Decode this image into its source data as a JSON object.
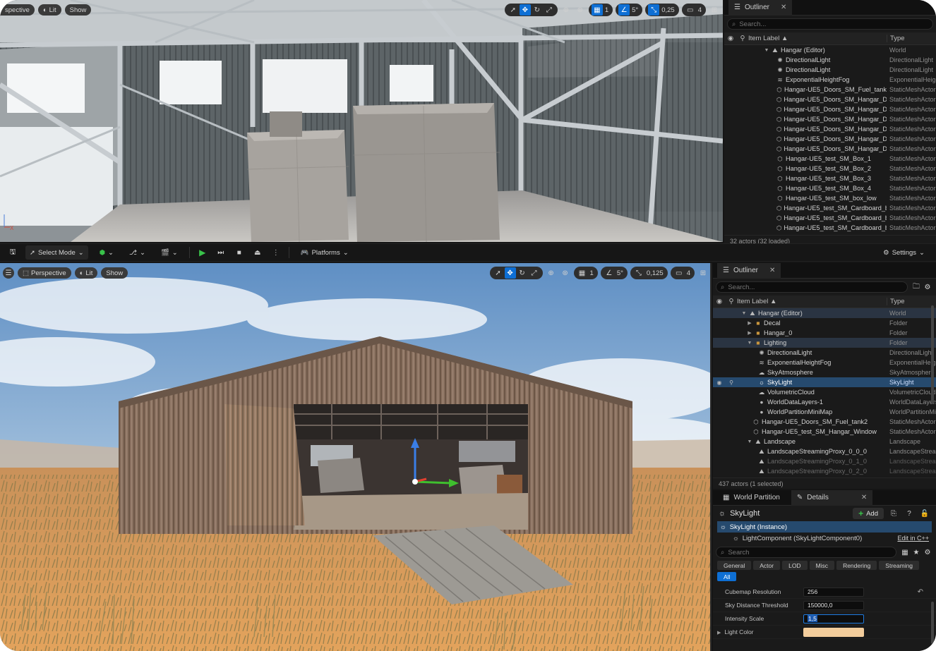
{
  "top_viewport": {
    "toolbar": {
      "mode": "spective",
      "lit": "Lit",
      "show": "Show"
    },
    "snap": {
      "grid": "1",
      "angle": "5°",
      "scale": "0,25",
      "cams": "4"
    }
  },
  "top_outliner": {
    "tab": "Outliner",
    "search_placeholder": "Search...",
    "col_label": "Item Label ▲",
    "col_type": "Type",
    "rows": [
      {
        "label": "Hangar (Editor)",
        "type": "World"
      },
      {
        "label": "DirectionalLight",
        "type": "DirectionalLight"
      },
      {
        "label": "DirectionalLight",
        "type": "DirectionalLight"
      },
      {
        "label": "ExponentialHeightFog",
        "type": "ExponentialHeightFog"
      },
      {
        "label": "Hangar-UE5_Doors_SM_Fuel_tank",
        "type": "StaticMeshActor"
      },
      {
        "label": "Hangar-UE5_Doors_SM_Hangar_Doo",
        "type": "StaticMeshActor"
      },
      {
        "label": "Hangar-UE5_Doors_SM_Hangar_Doo",
        "type": "StaticMeshActor"
      },
      {
        "label": "Hangar-UE5_Doors_SM_Hangar_Doo",
        "type": "StaticMeshActor"
      },
      {
        "label": "Hangar-UE5_Doors_SM_Hangar_Doo",
        "type": "StaticMeshActor"
      },
      {
        "label": "Hangar-UE5_Doors_SM_Hangar_Doo",
        "type": "StaticMeshActor"
      },
      {
        "label": "Hangar-UE5_Doors_SM_Hangar_Doo",
        "type": "StaticMeshActor"
      },
      {
        "label": "Hangar-UE5_test_SM_Box_1",
        "type": "StaticMeshActor"
      },
      {
        "label": "Hangar-UE5_test_SM_Box_2",
        "type": "StaticMeshActor"
      },
      {
        "label": "Hangar-UE5_test_SM_Box_3",
        "type": "StaticMeshActor"
      },
      {
        "label": "Hangar-UE5_test_SM_Box_4",
        "type": "StaticMeshActor"
      },
      {
        "label": "Hangar-UE5_test_SM_box_low",
        "type": "StaticMeshActor"
      },
      {
        "label": "Hangar-UE5_test_SM_Cardboard_box",
        "type": "StaticMeshActor"
      },
      {
        "label": "Hangar-UE5_test_SM_Cardboard_box",
        "type": "StaticMeshActor"
      },
      {
        "label": "Hangar-UE5_test_SM_Cardboard_box",
        "type": "StaticMeshActor"
      }
    ],
    "status": "32 actors (32 loaded)"
  },
  "main_toolbar": {
    "select_mode": "Select Mode",
    "platforms": "Platforms",
    "settings": "Settings"
  },
  "bottom_viewport": {
    "toolbar": {
      "mode": "Perspective",
      "lit": "Lit",
      "show": "Show"
    },
    "snap": {
      "grid": "1",
      "angle": "5°",
      "scale": "0,125",
      "cams": "4"
    }
  },
  "bottom_outliner": {
    "tab": "Outliner",
    "search_placeholder": "Search...",
    "col_label": "Item Label ▲",
    "col_type": "Type",
    "rows": [
      {
        "label": "Hangar (Editor)",
        "type": "World"
      },
      {
        "label": "Decal",
        "type": "Folder"
      },
      {
        "label": "Hangar_0",
        "type": "Folder"
      },
      {
        "label": "Lighting",
        "type": "Folder"
      },
      {
        "label": "DirectionalLight",
        "type": "DirectionalLight"
      },
      {
        "label": "ExponentialHeightFog",
        "type": "ExponentialHeightFog"
      },
      {
        "label": "SkyAtmosphere",
        "type": "SkyAtmosphere"
      },
      {
        "label": "SkyLight",
        "type": "SkyLight"
      },
      {
        "label": "VolumetricCloud",
        "type": "VolumetricCloud"
      },
      {
        "label": "WorldDataLayers-1",
        "type": "WorldDataLayers"
      },
      {
        "label": "WorldPartitionMiniMap",
        "type": "WorldPartitionMiniMap"
      },
      {
        "label": "Hangar-UE5_Doors_SM_Fuel_tank2",
        "type": "StaticMeshActor"
      },
      {
        "label": "Hangar-UE5_test_SM_Hangar_Window",
        "type": "StaticMeshActor"
      },
      {
        "label": "Landscape",
        "type": "Landscape"
      },
      {
        "label": "LandscapeStreamingProxy_0_0_0",
        "type": "LandscapeStreamingProxy"
      },
      {
        "label": "LandscapeStreamingProxy_0_1_0",
        "type": "LandscapeStreamingProxy"
      },
      {
        "label": "LandscapeStreamingProxy_0_2_0",
        "type": "LandscapeStreamingProxy"
      }
    ],
    "status": "437 actors (1 selected)"
  },
  "details": {
    "tabs": {
      "world_partition": "World Partition",
      "details": "Details"
    },
    "actor_name": "SkyLight",
    "add_label": "Add",
    "instance_row": "SkyLight (Instance)",
    "component_row": "LightComponent (SkyLightComponent0)",
    "edit_link": "Edit in C++",
    "search_placeholder": "Search",
    "filters": [
      "General",
      "Actor",
      "LOD",
      "Misc",
      "Rendering",
      "Streaming",
      "All"
    ],
    "props": {
      "cubemap_label": "Cubemap Resolution",
      "cubemap_value": "256",
      "sky_label": "Sky Distance Threshold",
      "sky_value": "150000,0",
      "intensity_label": "Intensity Scale",
      "intensity_value": "1,5",
      "color_label": "Light Color"
    }
  }
}
